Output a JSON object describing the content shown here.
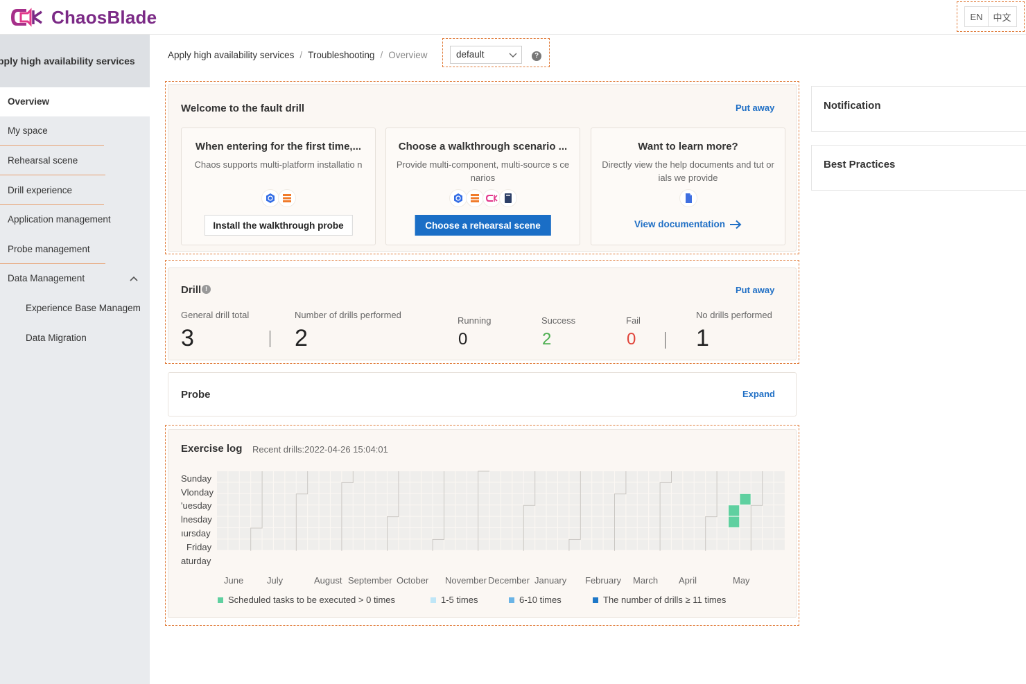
{
  "app": {
    "name": "ChaosBlade"
  },
  "lang": {
    "en": "EN",
    "zh": "中文"
  },
  "sidebar": {
    "header": "pply high availability services",
    "items": [
      {
        "label": "Overview"
      },
      {
        "label": "My space"
      },
      {
        "label": "Rehearsal scene"
      },
      {
        "label": "Drill experience"
      },
      {
        "label": "Application management"
      },
      {
        "label": "Probe management"
      },
      {
        "label": "Data Management"
      },
      {
        "label": "Experience Base Managem"
      },
      {
        "label": "Data Migration"
      }
    ]
  },
  "breadcrumb": {
    "items": [
      "Apply high availability services",
      "Troubleshooting",
      "Overview"
    ],
    "separator": "/"
  },
  "namespace": {
    "value": "default",
    "help": "?"
  },
  "welcome": {
    "title": "Welcome to the fault drill",
    "put_away": "Put away",
    "cards": [
      {
        "title": "When entering for the first time,...",
        "desc": "Chaos supports multi-platform installatio n",
        "button": "Install the walkthrough probe"
      },
      {
        "title": "Choose a walkthrough scenario ...",
        "desc": "Provide multi-component, multi-source s cenarios",
        "button": "Choose a rehearsal scene"
      },
      {
        "title": "Want to learn more?",
        "desc": "Directly view the help documents and tut orials we provide",
        "link": "View documentation"
      }
    ]
  },
  "drill": {
    "title": "Drill",
    "put_away": "Put away",
    "stats": {
      "general_total_label": "General drill total",
      "general_total": "3",
      "performed_label": "Number of drills performed",
      "performed": "2",
      "running_label": "Running",
      "running": "0",
      "success_label": "Success",
      "success": "2",
      "fail_label": "Fail",
      "fail": "0",
      "none_label": "No drills performed",
      "none": "1"
    }
  },
  "probe": {
    "title": "Probe",
    "expand": "Expand"
  },
  "exercise_log": {
    "title": "Exercise log",
    "recent": "Recent drills:2022-04-26 15:04:01",
    "days": [
      "Sunday",
      "Vlonday",
      "'uesday",
      "lnesday",
      "ıursday",
      "Friday",
      "aturday"
    ],
    "months": [
      "June",
      "July",
      "August",
      "September",
      "October",
      "November",
      "December",
      "January",
      "February",
      "March",
      "April",
      "May"
    ],
    "legend": [
      {
        "label": "Scheduled tasks to be executed > 0 times",
        "color": "#5fd0a0"
      },
      {
        "label": "1-5 times",
        "color": "#bfe6f7"
      },
      {
        "label": "6-10 times",
        "color": "#6ab4e6"
      },
      {
        "label": "The number of drills ≥ 11 times",
        "color": "#1e78c8"
      }
    ],
    "colors": {
      "empty": "#efeeec",
      "scheduled": "#5fd0a0"
    },
    "active_cells": [
      {
        "week": 46,
        "day": 2
      },
      {
        "week": 45,
        "day": 3
      },
      {
        "week": 45,
        "day": 4
      }
    ]
  },
  "right": {
    "notification": "Notification",
    "best_practices": "Best Practices"
  },
  "colors": {
    "accent": "#1a6ec6",
    "brand": "#7b2a86",
    "success": "#4caf50",
    "fail": "#e0443a",
    "dash": "#e07b39"
  }
}
